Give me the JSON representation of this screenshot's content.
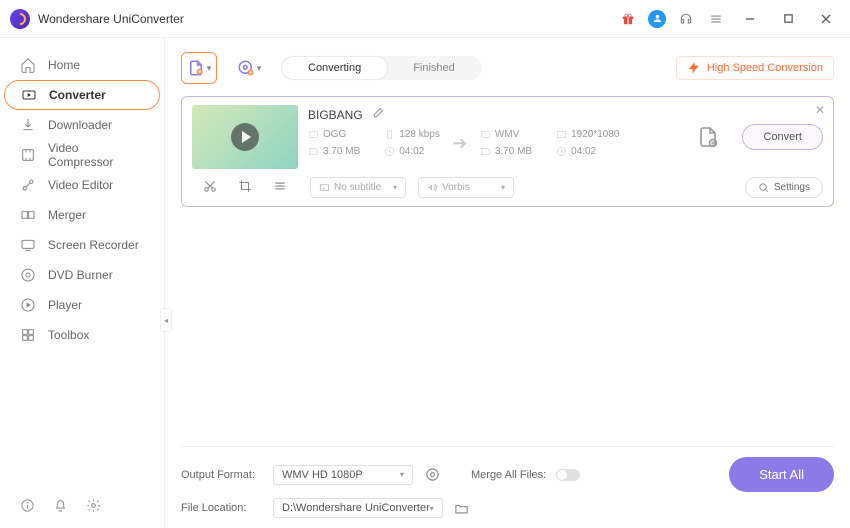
{
  "app": {
    "title": "Wondershare UniConverter"
  },
  "sidebar": {
    "items": [
      {
        "label": "Home"
      },
      {
        "label": "Converter"
      },
      {
        "label": "Downloader"
      },
      {
        "label": "Video Compressor"
      },
      {
        "label": "Video Editor"
      },
      {
        "label": "Merger"
      },
      {
        "label": "Screen Recorder"
      },
      {
        "label": "DVD Burner"
      },
      {
        "label": "Player"
      },
      {
        "label": "Toolbox"
      }
    ]
  },
  "toolbar": {
    "tabs": {
      "converting": "Converting",
      "finished": "Finished"
    },
    "hsc": "High Speed Conversion"
  },
  "file": {
    "title": "BIGBANG",
    "src": {
      "format": "OGG",
      "bitrate": "128 kbps",
      "size": "3.70 MB",
      "duration": "04:02"
    },
    "dst": {
      "format": "WMV",
      "resolution": "1920*1080",
      "size": "3.70 MB",
      "duration": "04:02"
    },
    "subtitle": "No subtitle",
    "audio": "Vorbis",
    "settings": "Settings",
    "convert": "Convert"
  },
  "footer": {
    "outputFormatLabel": "Output Format:",
    "outputFormat": "WMV HD 1080P",
    "mergeLabel": "Merge All Files:",
    "fileLocationLabel": "File Location:",
    "fileLocation": "D:\\Wondershare UniConverter",
    "startAll": "Start All"
  }
}
